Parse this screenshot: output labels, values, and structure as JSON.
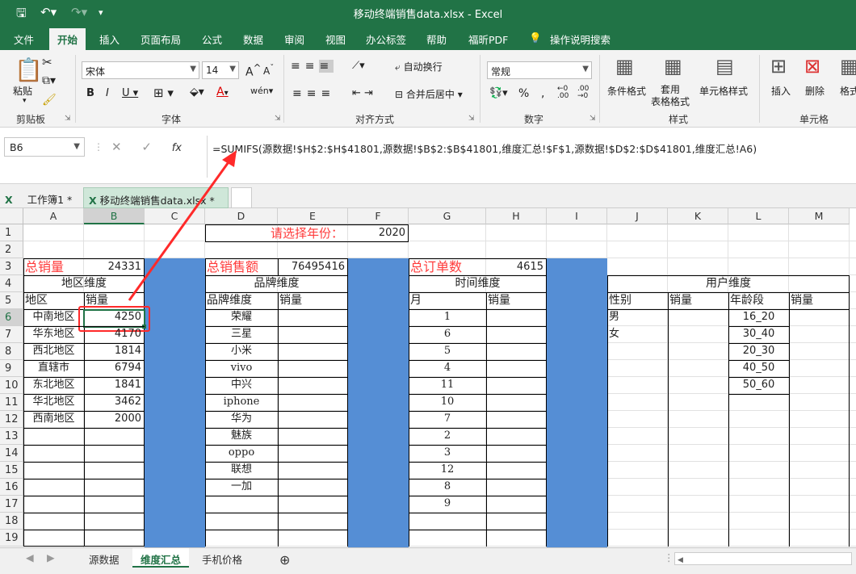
{
  "window": {
    "title": "移动终端销售data.xlsx  -  Excel"
  },
  "tabs": [
    "文件",
    "开始",
    "插入",
    "页面布局",
    "公式",
    "数据",
    "审阅",
    "视图",
    "办公标签",
    "帮助",
    "福昕PDF",
    "操作说明搜索"
  ],
  "ribbon": {
    "paste": "粘贴",
    "font_name": "宋体",
    "font_size": "14",
    "wrap": "自动换行",
    "merge": "合并后居中",
    "number_format": "常规",
    "cond_format": "条件格式",
    "table_format": "套用\n表格格式",
    "cell_style": "单元格样式",
    "insert": "插入",
    "delete": "删除",
    "format": "格式",
    "groups": [
      "剪贴板",
      "字体",
      "对齐方式",
      "数字",
      "样式",
      "单元格"
    ]
  },
  "namebox": "B6",
  "formula": "=SUMIFS(源数据!$H$2:$H$41801,源数据!$B$2:$B$41801,维度汇总!$F$1,源数据!$D$2:$D$41801,维度汇总!A6)",
  "workbook_tabs": [
    "工作簿1 *",
    "移动终端销售data.xlsx *"
  ],
  "columns": [
    "A",
    "B",
    "C",
    "D",
    "E",
    "F",
    "G",
    "H",
    "I",
    "J",
    "K",
    "L",
    "M"
  ],
  "rows": [
    "1",
    "2",
    "3",
    "4",
    "5",
    "6",
    "7",
    "8",
    "9",
    "10",
    "11",
    "12",
    "13",
    "14",
    "15",
    "16",
    "17",
    "18",
    "19"
  ],
  "cells": {
    "d1": "请选择年份：",
    "f1": "2020",
    "a3": "总销量",
    "b3": "24331",
    "d3": "总销售额",
    "e3": "76495416",
    "g3": "总订单数",
    "h3": "4615",
    "a4": "地区维度",
    "d4": "品牌维度",
    "g4": "时间维度",
    "j4": "用户维度",
    "a5": "地区",
    "b5": "销量",
    "d5": "品牌维度",
    "e5": "销量",
    "g5": "月",
    "h5": "销量",
    "j5": "性别",
    "k5": "销量",
    "l5": "年龄段",
    "m5": "销量"
  },
  "regions": [
    {
      "name": "中南地区",
      "value": "4250"
    },
    {
      "name": "华东地区",
      "value": "4170"
    },
    {
      "name": "西北地区",
      "value": "1814"
    },
    {
      "name": "直辖市",
      "value": "6794"
    },
    {
      "name": "东北地区",
      "value": "1841"
    },
    {
      "name": "华北地区",
      "value": "3462"
    },
    {
      "name": "西南地区",
      "value": "2000"
    }
  ],
  "brands": [
    "荣耀",
    "三星",
    "小米",
    "vivo",
    "中兴",
    "iphone",
    "华为",
    "魅族",
    "oppo",
    "联想",
    "一加"
  ],
  "months": [
    "1",
    "6",
    "5",
    "4",
    "11",
    "10",
    "7",
    "2",
    "3",
    "12",
    "8",
    "9"
  ],
  "genders": [
    "男",
    "女"
  ],
  "ages": [
    "16_20",
    "30_40",
    "20_30",
    "40_50",
    "50_60"
  ],
  "sheet_tabs": [
    "源数据",
    "维度汇总",
    "手机价格"
  ],
  "colors": {
    "accent": "#217346",
    "red": "#ff3b3b",
    "blue": "#558ed5"
  }
}
